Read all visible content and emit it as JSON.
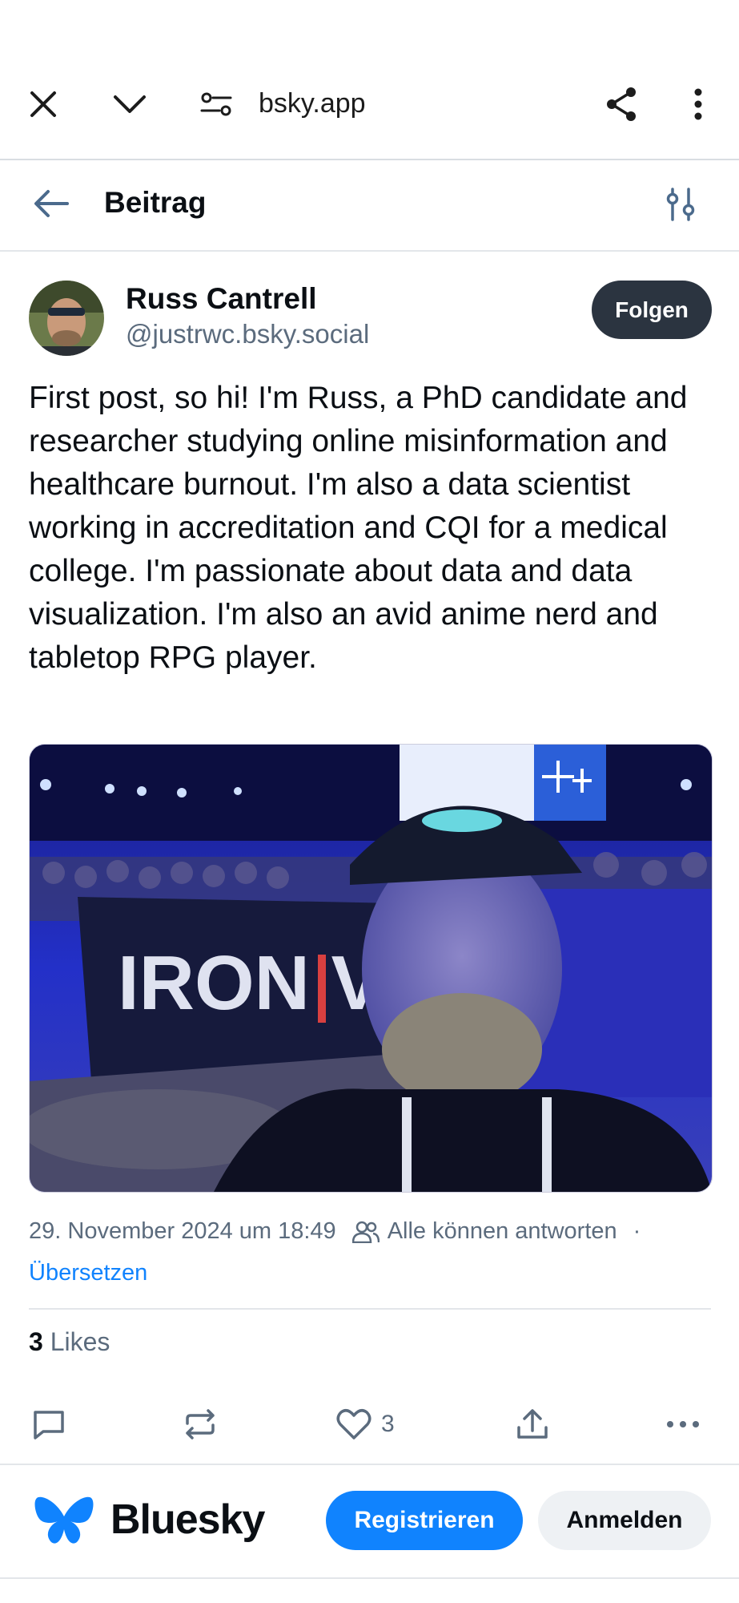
{
  "browser": {
    "url": "bsky.app",
    "icons": [
      "close-icon",
      "chevron-down-icon",
      "site-settings-icon",
      "share-icon",
      "more-vertical-icon"
    ]
  },
  "header": {
    "title": "Beitrag",
    "icons": [
      "back-arrow-icon",
      "filter-sliders-icon"
    ]
  },
  "post": {
    "author_name": "Russ Cantrell",
    "author_handle": "@justrwc.bsky.social",
    "follow_label": "Folgen",
    "text": "First post, so hi! I'm Russ, a PhD candidate and researcher studying online misinformation and healthcare burnout. I'm also a data scientist working in accreditation and CQI for a medical college. I'm passionate about data and data visualization. I'm also an avid anime nerd and tabletop RPG player.",
    "image_text": "IRON VIZ",
    "timestamp": "29. November 2024 um 18:49",
    "reply_setting": "Alle können antworten",
    "meta_separator": "·",
    "translate_label": "Übersetzen",
    "likes_count": "3",
    "likes_label": "Likes",
    "like_button_count": "3"
  },
  "footer": {
    "brand": "Bluesky",
    "register_label": "Registrieren",
    "login_label": "Anmelden",
    "brand_color": "#1083fe"
  }
}
